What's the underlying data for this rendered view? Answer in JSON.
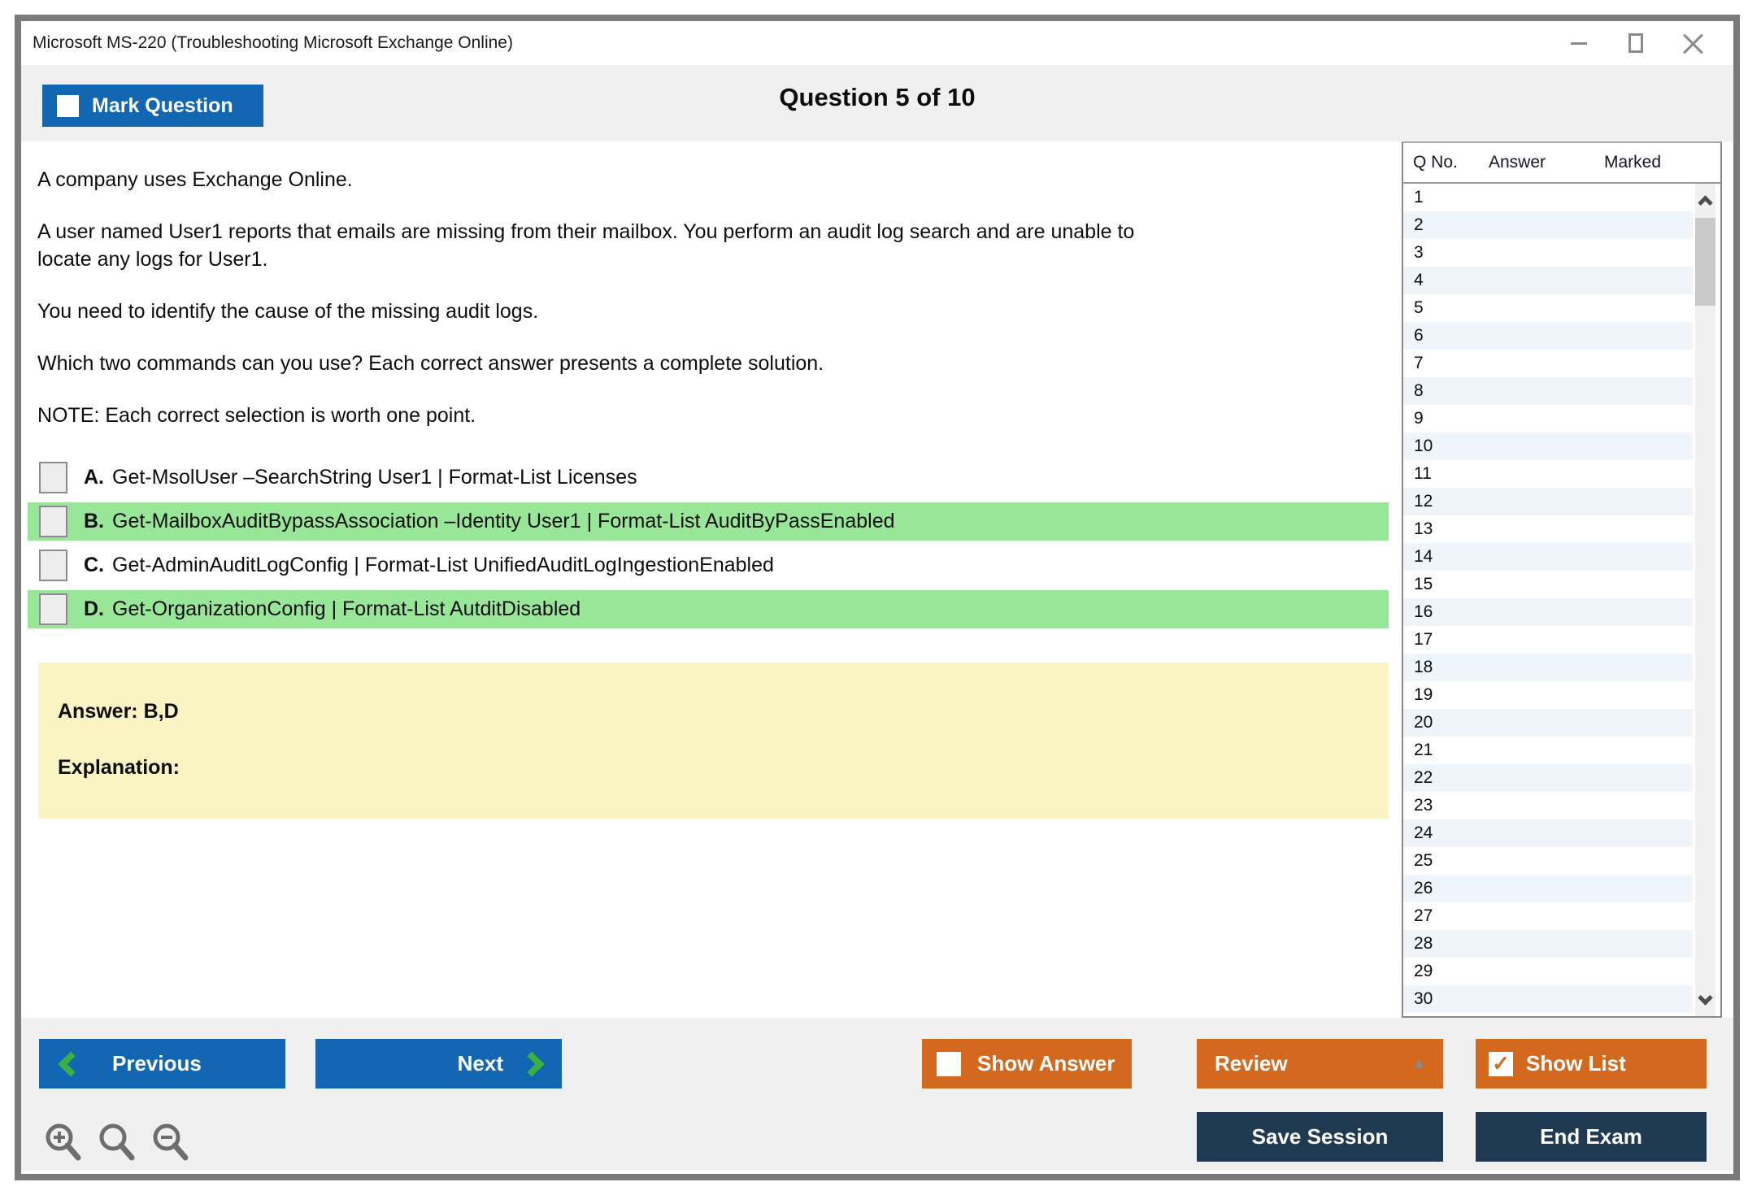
{
  "window": {
    "title": "Microsoft MS-220 (Troubleshooting Microsoft Exchange Online)"
  },
  "header": {
    "mark_question_label": "Mark Question",
    "question_counter": "Question 5 of 10"
  },
  "question": {
    "paragraphs": [
      "A company uses Exchange Online.",
      "A user named User1 reports that emails are missing from their mailbox. You perform an audit log search and are unable to\nlocate any logs for User1.",
      "You need to identify the cause of the missing audit logs.",
      "Which two commands can you use? Each correct answer presents a complete solution.",
      "NOTE: Each correct selection is worth one point."
    ],
    "options": [
      {
        "letter": "A.",
        "text": "Get-MsolUser –SearchString User1 | Format-List Licenses",
        "highlighted": false
      },
      {
        "letter": "B.",
        "text": "Get-MailboxAuditBypassAssociation –Identity User1 | Format-List AuditByPassEnabled",
        "highlighted": true
      },
      {
        "letter": "C.",
        "text": "Get-AdminAuditLogConfig | Format-List UnifiedAuditLogIngestionEnabled",
        "highlighted": false
      },
      {
        "letter": "D.",
        "text": "Get-OrganizationConfig | Format-List AutditDisabled",
        "highlighted": true
      }
    ],
    "answer_label": "Answer: B,D",
    "explanation_label": "Explanation:"
  },
  "sidebar": {
    "columns": [
      "Q No.",
      "Answer",
      "Marked"
    ],
    "rows": [
      "1",
      "2",
      "3",
      "4",
      "5",
      "6",
      "7",
      "8",
      "9",
      "10",
      "11",
      "12",
      "13",
      "14",
      "15",
      "16",
      "17",
      "18",
      "19",
      "20",
      "21",
      "22",
      "23",
      "24",
      "25",
      "26",
      "27",
      "28",
      "29",
      "30"
    ]
  },
  "footer": {
    "previous_label": "Previous",
    "next_label": "Next",
    "show_answer_label": "Show Answer",
    "review_label": "Review",
    "show_list_label": "Show List",
    "save_session_label": "Save Session",
    "end_exam_label": "End Exam",
    "show_list_check": "✓",
    "review_caret": "▲"
  },
  "colors": {
    "accent_blue": "#1266b2",
    "accent_orange": "#d2691e",
    "accent_navy": "#203a52",
    "highlight_green": "#98e798",
    "answer_yellow": "#faf4c2",
    "chevron_green": "#3cb043"
  }
}
